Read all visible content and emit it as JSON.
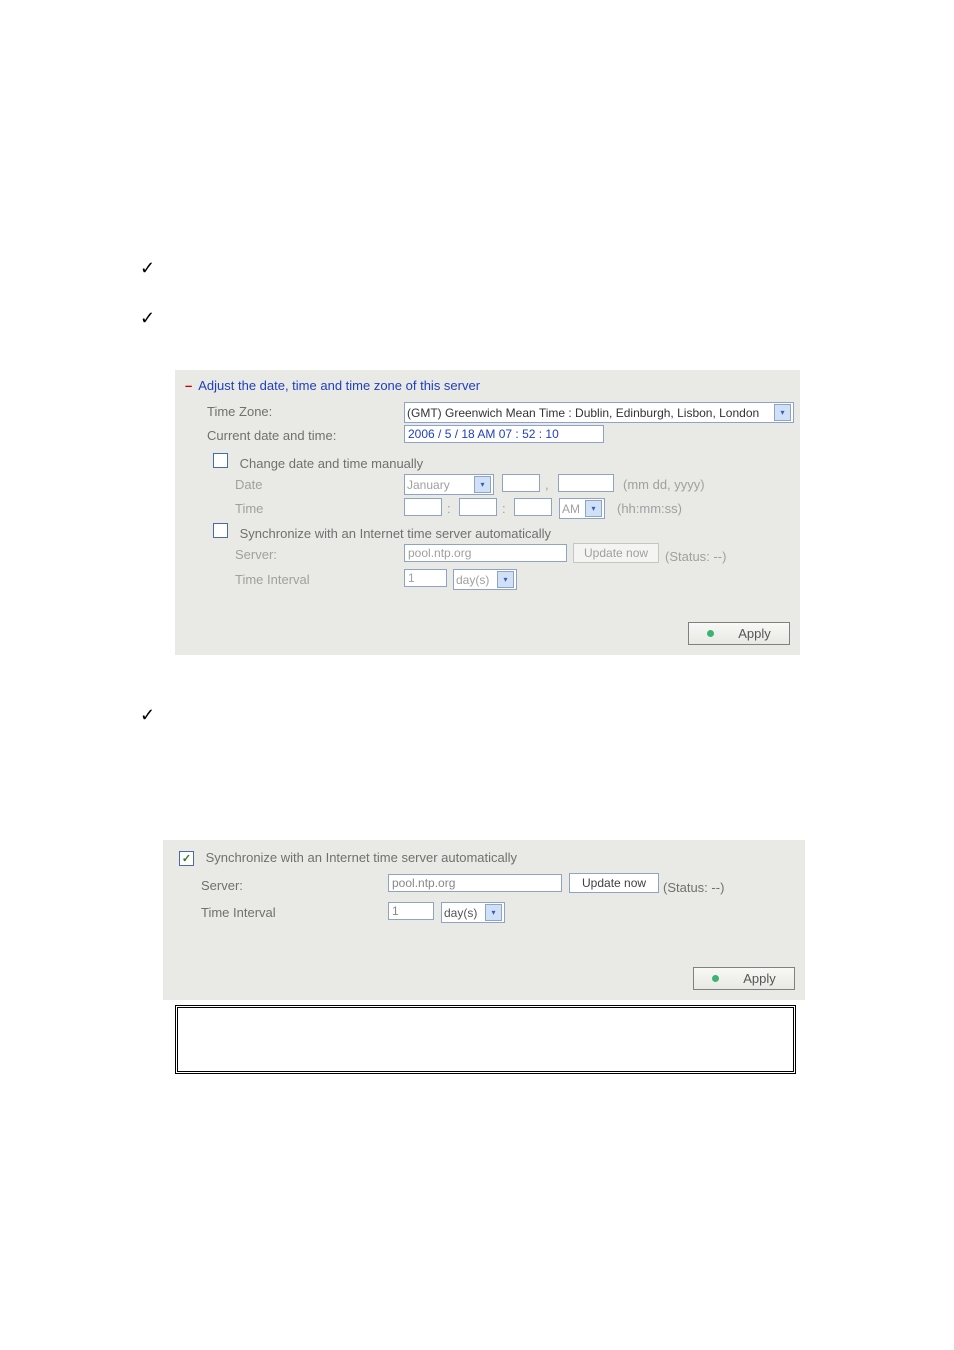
{
  "checks": [
    "✓",
    "✓",
    "✓"
  ],
  "panel1": {
    "title": "Adjust the date, time and time zone of this server",
    "timezone_label": "Time Zone:",
    "timezone_value": "(GMT) Greenwich Mean Time : Dublin, Edinburgh, Lisbon, London",
    "current_label": "Current date and time:",
    "current_value": "2006 / 5 / 18 AM 07 : 52 : 10",
    "change_manually": "Change date and time manually",
    "date_label": "Date",
    "date_month": "January",
    "date_sep": ",",
    "date_hint": "(mm dd, yyyy)",
    "time_label": "Time",
    "time_colon": ":",
    "time_ampm": "AM",
    "time_hint": "(hh:mm:ss)",
    "sync_label": "Synchronize with an Internet time server automatically",
    "server_label": "Server:",
    "server_value": "pool.ntp.org",
    "update_now": "Update now",
    "status": "(Status: --)",
    "interval_label": "Time Interval",
    "interval_value": "1",
    "interval_unit": "day(s)",
    "apply": "Apply"
  },
  "panel2": {
    "sync_label": "Synchronize with an Internet time server automatically",
    "server_label": "Server:",
    "server_value": "pool.ntp.org",
    "update_now": "Update now",
    "status": "(Status: --)",
    "interval_label": "Time Interval",
    "interval_value": "1",
    "interval_unit": "day(s)",
    "apply": "Apply"
  }
}
